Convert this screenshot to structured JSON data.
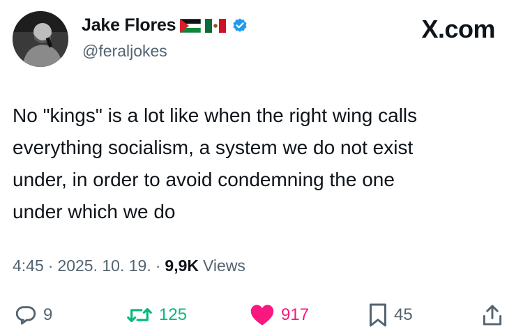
{
  "author": {
    "display_name": "Jake Flores",
    "handle": "@feraljokes",
    "flags": [
      "palestine-flag-icon",
      "mexico-flag-icon"
    ],
    "verified": true
  },
  "brand": "X.com",
  "tweet": {
    "text": "No \"kings\" is a lot like when the right wing calls\neverything socialism, a system we do not exist\nunder, in order to avoid condemning the one\nunder which we do"
  },
  "meta": {
    "time": "4:45",
    "sep1": "·",
    "date": "2025. 10. 19.",
    "sep2": "·",
    "views_count": "9,9K",
    "views_label": "Views"
  },
  "actions": {
    "replies": "9",
    "reposts": "125",
    "likes": "917",
    "bookmarks": "45"
  },
  "colors": {
    "text": "#0f1419",
    "secondary": "#536471",
    "repost_active": "#00ba7c",
    "like_active": "#f91880",
    "verified": "#1d9bf0"
  }
}
